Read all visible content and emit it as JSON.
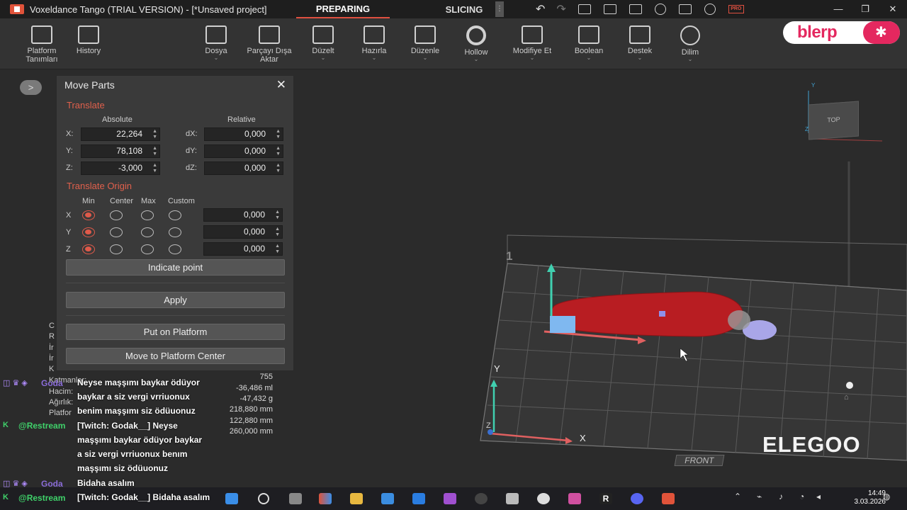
{
  "window": {
    "title": "Voxeldance Tango (TRIAL VERSION) - [*Unsaved project]",
    "modes": [
      "PREPARING",
      "SLICING"
    ],
    "active_mode": "PREPARING",
    "accent": "#e05040"
  },
  "toolbar": {
    "items": [
      {
        "label": "Platform Tanımları",
        "icon": "platform-settings-icon"
      },
      {
        "label": "History",
        "icon": "history-icon"
      },
      {
        "label": "Dosya",
        "icon": "folder-icon"
      },
      {
        "label": "Parçayı Dışa Aktar",
        "icon": "export-icon"
      },
      {
        "label": "Düzelt",
        "icon": "repair-icon"
      },
      {
        "label": "Hazırla",
        "icon": "move-icon"
      },
      {
        "label": "Düzenle",
        "icon": "edit-icon"
      },
      {
        "label": "Hollow",
        "icon": "hollow-icon"
      },
      {
        "label": "Modifiye Et",
        "icon": "modify-icon"
      },
      {
        "label": "Boolean",
        "icon": "boolean-icon"
      },
      {
        "label": "Destek",
        "icon": "support-icon"
      },
      {
        "label": "Dilim",
        "icon": "slice-icon"
      }
    ],
    "overlay_logo": "blerp"
  },
  "move_panel": {
    "title": "Move Parts",
    "translate_title": "Translate",
    "absolute_label": "Absolute",
    "relative_label": "Relative",
    "absolute": {
      "x_label": "X:",
      "x": "22,264",
      "y_label": "Y:",
      "y": "78,108",
      "z_label": "Z:",
      "z": "-3,000"
    },
    "relative": {
      "dx_label": "dX:",
      "dx": "0,000",
      "dy_label": "dY:",
      "dy": "0,000",
      "dz_label": "dZ:",
      "dz": "0,000"
    },
    "origin_title": "Translate Origin",
    "origin_cols": [
      "Min",
      "Center",
      "Max",
      "Custom"
    ],
    "origin_rows": [
      {
        "axis": "X",
        "selected": "Min",
        "custom_value": "0,000"
      },
      {
        "axis": "Y",
        "selected": "Min",
        "custom_value": "0,000"
      },
      {
        "axis": "Z",
        "selected": "Min",
        "custom_value": "0,000"
      }
    ],
    "indicate_point": "Indicate point",
    "apply": "Apply",
    "put_on_platform": "Put on Platform",
    "move_to_center": "Move to Platform Center"
  },
  "info": {
    "rows": [
      {
        "label": "Katmanlar:",
        "value": "755"
      },
      {
        "label": "Hacim:",
        "value": "-36,486 ml"
      },
      {
        "label": "Ağırlık:",
        "value": "-47,432 g"
      },
      {
        "label": "Platfor",
        "value": "218,880 mm"
      },
      {
        "label": "",
        "value": "122,880 mm"
      },
      {
        "label": "",
        "value": "260,000 mm"
      }
    ]
  },
  "chat": [
    {
      "user": "Goda",
      "user_color": "#8a6cd8",
      "message_lines": [
        "Neyse maşşımı baykar ödüyor",
        "baykar a siz vergi vrriuonux",
        "benim maşşımı siz ödüuonuz"
      ]
    },
    {
      "user": "@Restream",
      "user_color": "#3fd16a",
      "message_lines": [
        "[Twitch: Godak__] Neyse",
        "maşşımı baykar ödüyor baykar",
        "a siz vergi vrriuonux benım",
        "maşşımı siz ödüuonuz"
      ]
    },
    {
      "user": "Goda",
      "user_color": "#8a6cd8",
      "message_lines": [
        "Bidaha asalım"
      ]
    },
    {
      "user": "@Restream",
      "user_color": "#3fd16a",
      "message_lines": [
        "[Twitch: Godak__] Bidaha asalım"
      ]
    }
  ],
  "viewport": {
    "navcube_label": "TOP",
    "front_label": "FRONT",
    "axis_x": "X",
    "axis_y": "Y",
    "axis_z": "Z",
    "plate_number": "1",
    "brand": "ELEGOO"
  },
  "taskbar": {
    "time": "14:49",
    "date": "3.03.2026"
  }
}
